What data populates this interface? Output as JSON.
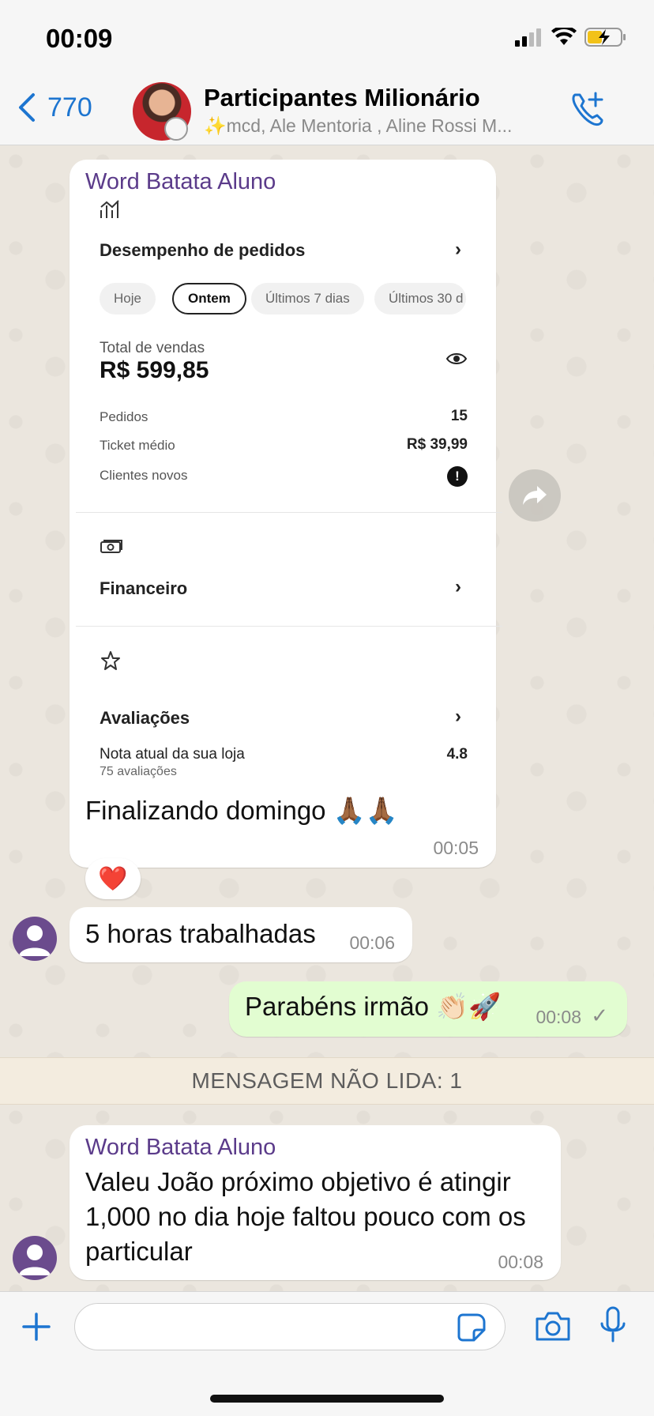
{
  "status_bar": {
    "time": "00:09"
  },
  "header": {
    "back_count": "770",
    "group_title": "Participantes Milionário",
    "group_subtitle": "✨mcd, Ale Mentoria , Aline Rossi M..."
  },
  "messages": [
    {
      "sender": "Word Batata Aluno",
      "card": {
        "section1_title": "Desempenho de pedidos",
        "filters": [
          "Hoje",
          "Ontem",
          "Últimos 7 dias",
          "Últimos 30 d"
        ],
        "active_filter": "Ontem",
        "total_label": "Total de vendas",
        "total_value": "R$ 599,85",
        "rows": [
          {
            "label": "Pedidos",
            "value": "15"
          },
          {
            "label": "Ticket médio",
            "value": "R$ 39,99"
          },
          {
            "label": "Clientes novos",
            "value": "!"
          }
        ],
        "section2_title": "Financeiro",
        "section3_title": "Avaliações",
        "rating_label": "Nota atual da sua loja",
        "rating_count": "75 avaliações",
        "rating_value": "4.8"
      },
      "text": "Finalizando domingo 🙏🏾🙏🏾",
      "time": "00:05",
      "reaction": "❤️"
    },
    {
      "text": "5 horas trabalhadas",
      "time": "00:06"
    },
    {
      "text": "Parabéns irmão 👏🏻🚀",
      "time": "00:08",
      "status": "✓"
    },
    {
      "sender": "Word Batata Aluno",
      "text": "Valeu João próximo objetivo é atingir 1,000 no dia hoje faltou pouco com os particular",
      "time": "00:08"
    }
  ],
  "unread_banner": "MENSAGEM NÃO LIDA: 1",
  "input": {
    "placeholder": ""
  },
  "colors": {
    "accent": "#1d75d0",
    "sender": "#5b3b8a",
    "outgoing": "#e2fdd1",
    "background": "#ece7df"
  },
  "icons": [
    "back-chevron-icon",
    "add-call-icon",
    "plus-icon",
    "sticker-icon",
    "camera-icon",
    "mic-icon",
    "forward-icon",
    "chart-icon",
    "money-icon",
    "star-icon",
    "eye-icon"
  ]
}
